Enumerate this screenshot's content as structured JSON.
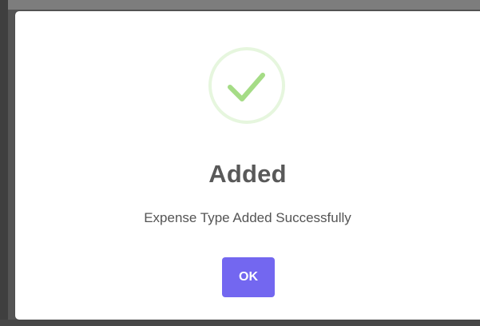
{
  "dialog": {
    "icon": "check-icon",
    "title": "Added",
    "message": "Expense Type Added Successfully",
    "ok_label": "OK"
  },
  "colors": {
    "accent": "#7367f0",
    "success": "#a5dc86",
    "success_ring": "#e6f6de",
    "text": "#595959"
  }
}
